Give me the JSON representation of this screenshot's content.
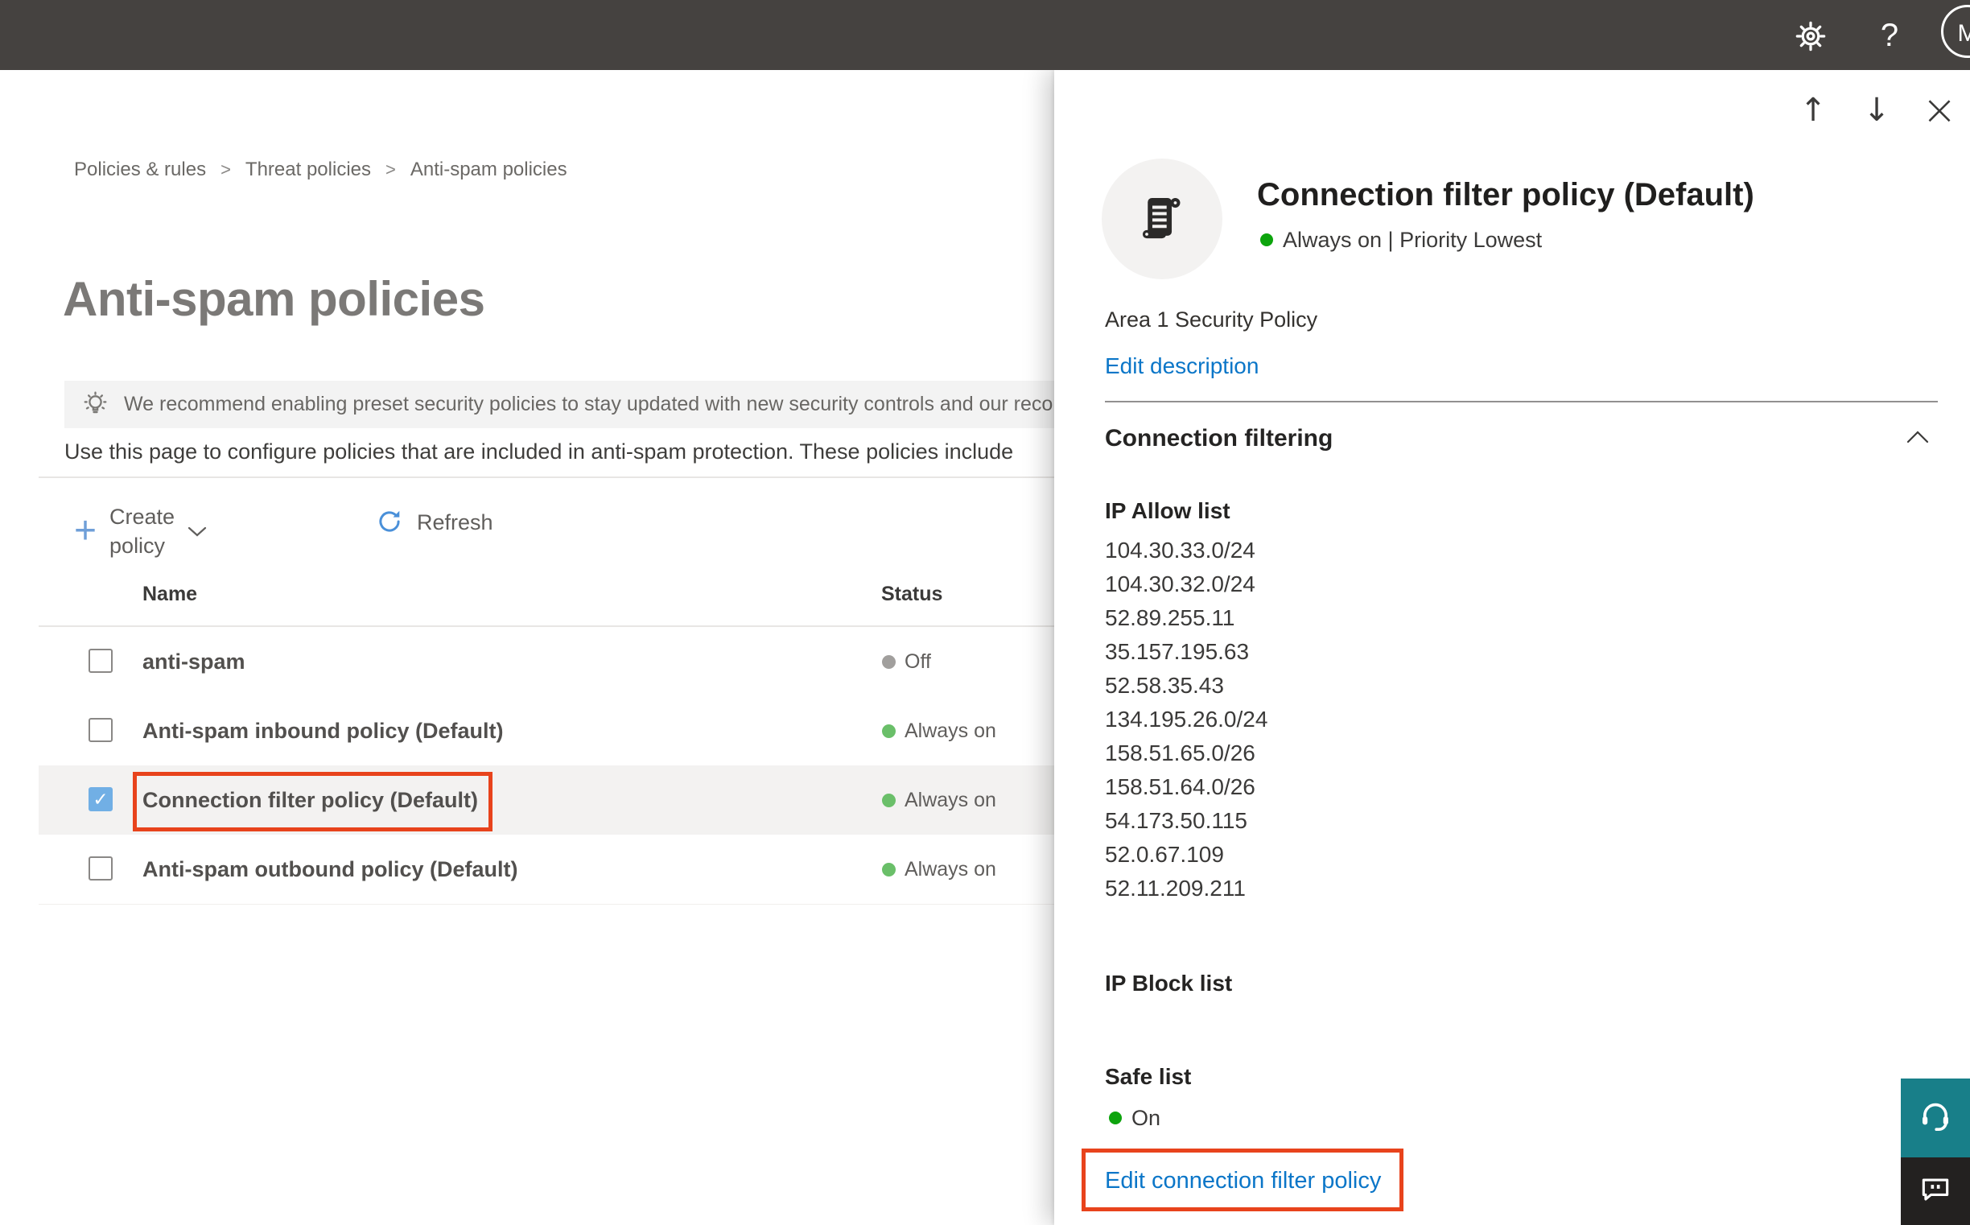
{
  "topbar": {
    "avatar_initial": "M"
  },
  "icons": {
    "help": "?",
    "close": "×",
    "up": "↑",
    "down": "↓",
    "plus": "+",
    "check": "✓"
  },
  "breadcrumb": {
    "separator": ">",
    "items": [
      "Policies & rules",
      "Threat policies",
      "Anti-spam policies"
    ]
  },
  "page": {
    "title": "Anti-spam policies",
    "banner_text": "We recommend enabling preset security policies to stay updated with new security controls and our recomme",
    "description": "Use this page to configure policies that are included in anti-spam protection. These policies include",
    "toolbar": {
      "create_label": "Create policy",
      "refresh_label": "Refresh"
    },
    "table": {
      "columns": [
        "Name",
        "Status"
      ],
      "rows": [
        {
          "name": "anti-spam",
          "status": "Off",
          "checked": false,
          "selected": false
        },
        {
          "name": "Anti-spam inbound policy (Default)",
          "status": "Always on",
          "checked": false,
          "selected": false
        },
        {
          "name": "Connection filter policy (Default)",
          "status": "Always on",
          "checked": true,
          "selected": true,
          "annotated": true
        },
        {
          "name": "Anti-spam outbound policy (Default)",
          "status": "Always on",
          "checked": false,
          "selected": false
        }
      ]
    }
  },
  "flyout": {
    "title": "Connection filter policy (Default)",
    "status_line": "Always on | Priority Lowest",
    "description": "Area 1 Security Policy",
    "edit_description_label": "Edit description",
    "section_title": "Connection filtering",
    "ip_allow": {
      "label": "IP Allow list",
      "entries": [
        "104.30.33.0/24",
        "104.30.32.0/24",
        "52.89.255.11",
        "35.157.195.63",
        "52.58.35.43",
        "134.195.26.0/24",
        "158.51.65.0/26",
        "158.51.64.0/26",
        "54.173.50.115",
        "52.0.67.109",
        "52.11.209.211"
      ]
    },
    "ip_block": {
      "label": "IP Block list"
    },
    "safe_list": {
      "label": "Safe list",
      "value": "On"
    },
    "edit_link_label": "Edit connection filter policy"
  },
  "colors": {
    "topbar_bg": "#454240",
    "accent_link": "#0b76c8",
    "annotation_red": "#e8431c",
    "status_green_table": "#6abf69",
    "status_green_flyout": "#0da40d",
    "status_gray": "#a19f9d",
    "checkbox_blue": "#71afe5",
    "selected_row_bg": "#f3f2f1",
    "banner_bg": "#f3f3f3",
    "teal_button": "#187f89",
    "dark_button": "#232120"
  }
}
